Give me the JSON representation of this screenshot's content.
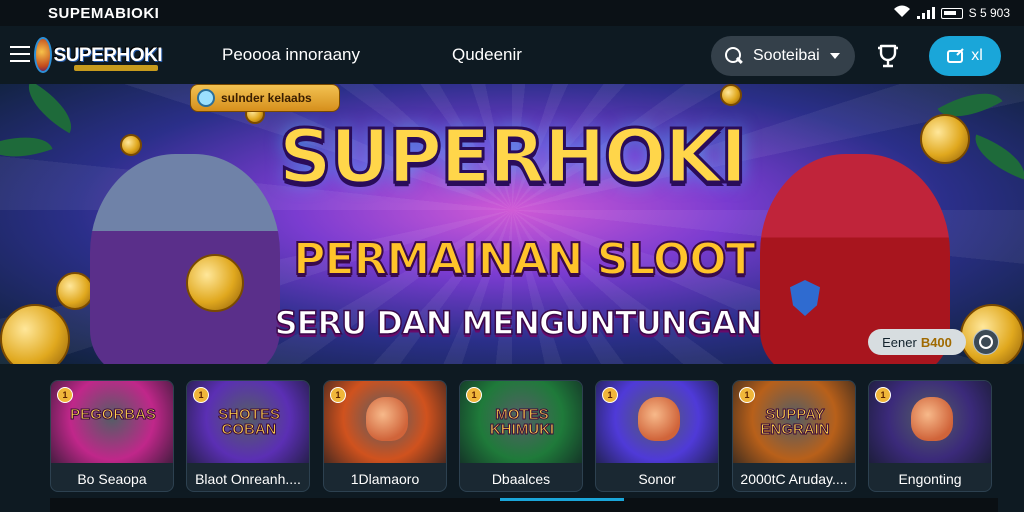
{
  "status_bar": {
    "title": "SUPEMABIOKI",
    "right_text": "S 5 903"
  },
  "navbar": {
    "logo_text": "SUPERHOKI",
    "links": [
      "Peoooa innoraany",
      "Qudeenir"
    ],
    "search_label": "Sooteibai",
    "login_label": "xl"
  },
  "hero": {
    "promo_pill": "sulnder kelaabs",
    "title": "SUPERHOKI",
    "subtitle": "PERMAINAN SLOOT",
    "tagline": "SERU DAN MENGUNTUNGAN",
    "balance_label": "Eener",
    "balance_value": "B400"
  },
  "games": [
    {
      "label": "Bo Seaopa",
      "badge": "1",
      "logo": "PEGORBAS",
      "color": "#c0278a"
    },
    {
      "label": "Blaot Onreanh....",
      "badge": "1",
      "logo": "SHOTES COBAN",
      "color": "#5b2fb4"
    },
    {
      "label": "1Dlamaoro",
      "badge": "1",
      "logo": "",
      "color": "#d0521e"
    },
    {
      "label": "Dbaalces",
      "badge": "1",
      "logo": "MOTES KHIMUKI",
      "color": "#1f7a3a"
    },
    {
      "label": "Sonor",
      "badge": "1",
      "logo": "",
      "color": "#4f3ad8"
    },
    {
      "label": "2000tC Aruday....",
      "badge": "1",
      "logo": "SUPPAY ENGRAIN",
      "color": "#b8601a"
    },
    {
      "label": "Engonting",
      "badge": "1",
      "logo": "",
      "color": "#3b2a7a"
    }
  ],
  "colors": {
    "accent": "#1aa6d9",
    "bg": "#0e1a22",
    "gold": "#ffd64a"
  }
}
